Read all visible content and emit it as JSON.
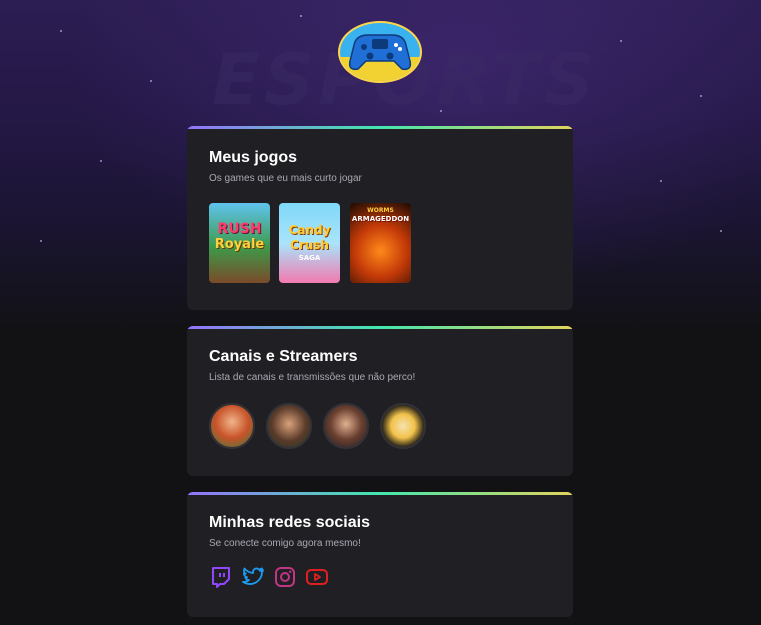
{
  "header": {
    "background_word": "ESPORTS",
    "avatar_icon": "gamepad-icon"
  },
  "sections": {
    "games": {
      "title": "Meus jogos",
      "subtitle": "Os games que eu mais curto jogar",
      "items": [
        {
          "name_line1": "RUSH",
          "name_line2": "Royale",
          "icon": "rush-royale-cover"
        },
        {
          "name_line1": "Candy",
          "name_line2": "Crush",
          "name_line3": "SAGA",
          "icon": "candy-crush-cover"
        },
        {
          "name_line1": "WORMS",
          "name_line2": "ARMAGEDDON",
          "icon": "worms-armageddon-cover"
        }
      ]
    },
    "channels": {
      "title": "Canais e Streamers",
      "subtitle": "Lista de canais e transmissões que não perco!",
      "items": [
        {
          "icon": "streamer-avatar-1"
        },
        {
          "icon": "streamer-avatar-2"
        },
        {
          "icon": "streamer-avatar-3"
        },
        {
          "icon": "streamer-avatar-4"
        }
      ]
    },
    "social": {
      "title": "Minhas redes sociais",
      "subtitle": "Se conecte comigo agora mesmo!",
      "items": [
        {
          "icon": "twitch-icon",
          "color": "#9146ff"
        },
        {
          "icon": "twitter-icon",
          "color": "#1d9bf0"
        },
        {
          "icon": "instagram-icon",
          "color": "#c13584"
        },
        {
          "icon": "youtube-icon",
          "color": "#e02020"
        }
      ]
    }
  },
  "colors": {
    "card_bg": "#202024",
    "page_bg": "#121214",
    "gradient": [
      "#9572fc",
      "#43e7ad",
      "#e2d45c"
    ]
  }
}
